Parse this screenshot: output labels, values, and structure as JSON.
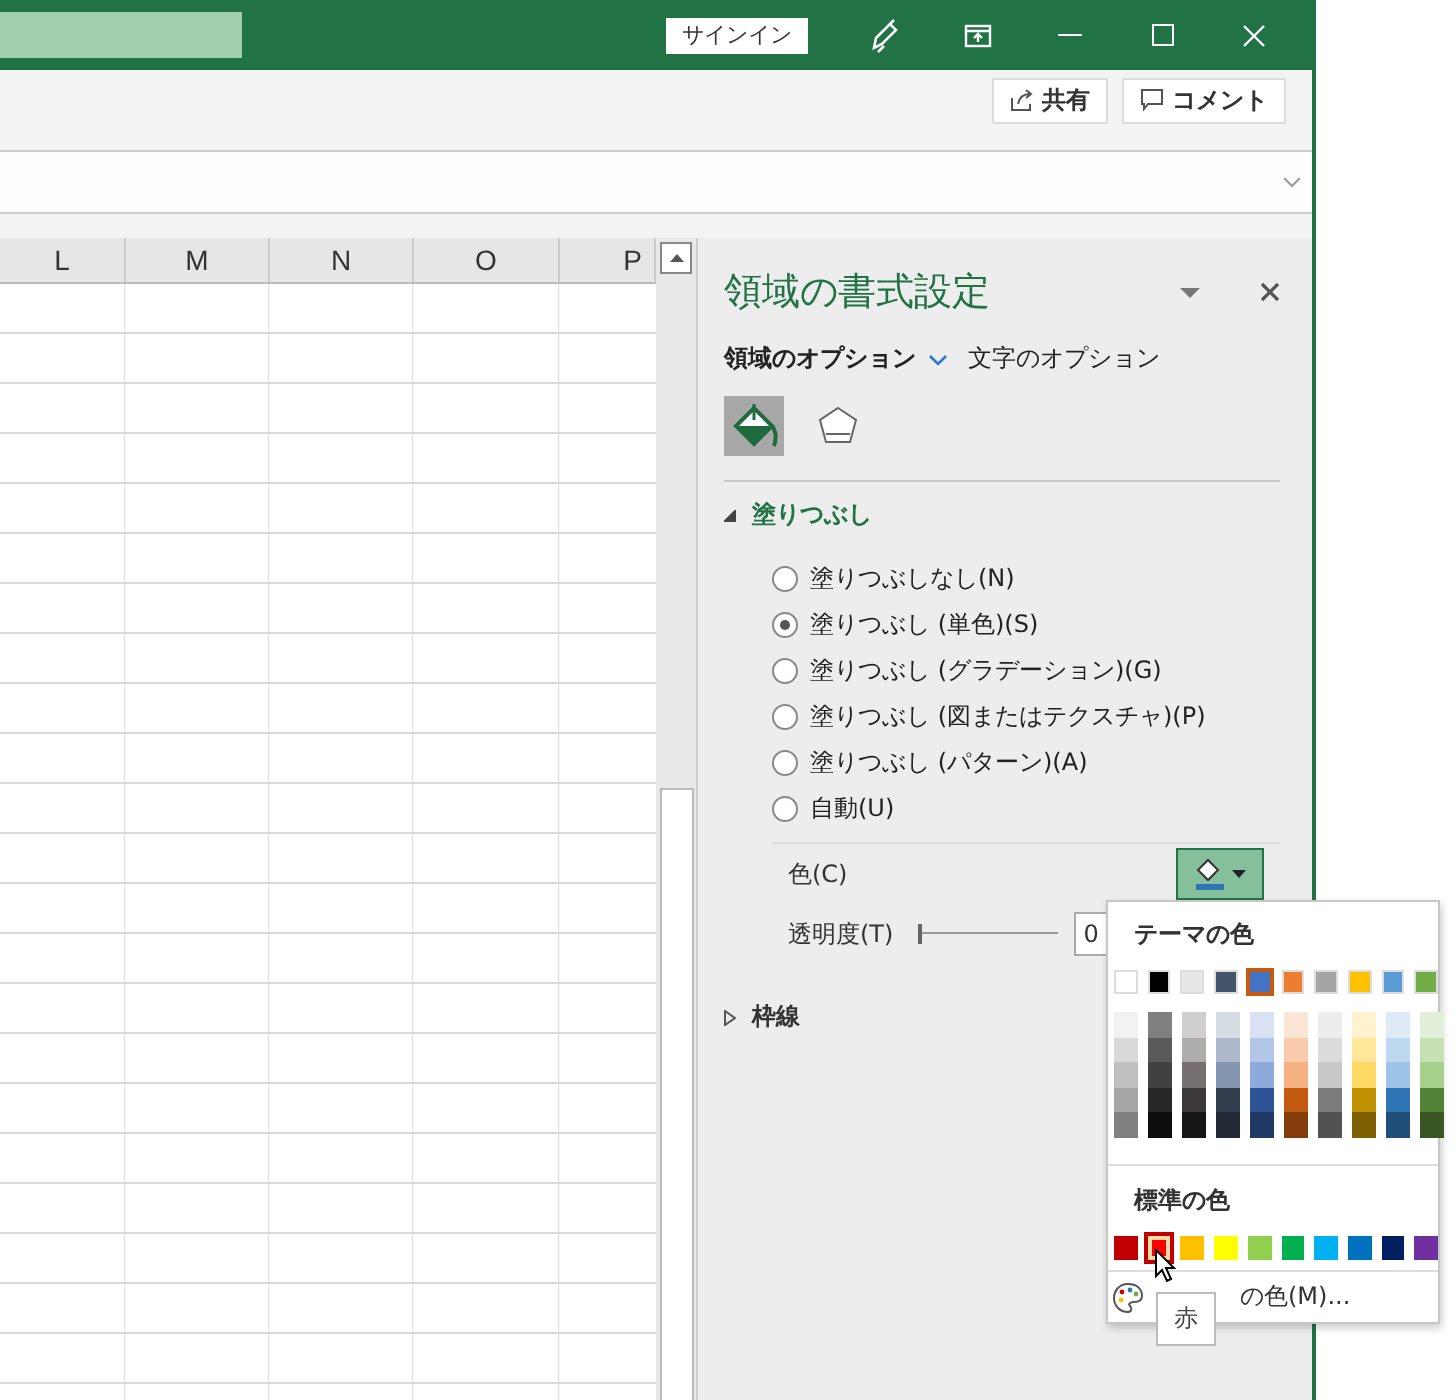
{
  "title_bar": {
    "signin_button": "サインイン"
  },
  "ribbon": {
    "buttons": [
      "共有",
      "コメント"
    ]
  },
  "sheet": {
    "columns": [
      "L",
      "M",
      "N",
      "O",
      "P"
    ]
  },
  "pane": {
    "title": "領域の書式設定",
    "tabs": [
      {
        "label": "領域のオプション",
        "selected": true
      },
      {
        "label": "文字のオプション",
        "selected": false
      }
    ],
    "icon_tabs": [
      {
        "kind": "fill",
        "selected": true
      },
      {
        "kind": "effects",
        "selected": false
      }
    ],
    "fill_section": {
      "label": "塗りつぶし",
      "expanded": true,
      "options": [
        {
          "label": "塗りつぶしなし(N)",
          "selected": false
        },
        {
          "label": "塗りつぶし (単色)(S)",
          "selected": true
        },
        {
          "label": "塗りつぶし (グラデーション)(G)",
          "selected": false
        },
        {
          "label": "塗りつぶし (図またはテクスチャ)(P)",
          "selected": false
        },
        {
          "label": "塗りつぶし (パターン)(A)",
          "selected": false
        },
        {
          "label": "自動(U)",
          "selected": false
        }
      ],
      "color_label": "色(C)",
      "transparency": {
        "label": "透明度(T)",
        "level": 0,
        "value": "0"
      }
    },
    "border_section": {
      "label": "枠線",
      "expanded": false
    }
  },
  "color_popup": {
    "theme_label": "テーマの色",
    "theme_colors": [
      {
        "color": "#ffffff",
        "selected": false,
        "shades": [
          {
            "color": "#f2f2f2"
          },
          {
            "color": "#d9d9d9"
          },
          {
            "color": "#bfbfbf"
          },
          {
            "color": "#a6a6a6"
          },
          {
            "color": "#808080"
          }
        ]
      },
      {
        "color": "#000000",
        "selected": false,
        "shades": [
          {
            "color": "#7f7f7f"
          },
          {
            "color": "#595959"
          },
          {
            "color": "#404040"
          },
          {
            "color": "#262626"
          },
          {
            "color": "#0d0d0d"
          }
        ]
      },
      {
        "color": "#e7e6e6",
        "selected": false,
        "shades": [
          {
            "color": "#d0cece"
          },
          {
            "color": "#aeabab"
          },
          {
            "color": "#757171"
          },
          {
            "color": "#3a3838"
          },
          {
            "color": "#171616"
          }
        ]
      },
      {
        "color": "#44546a",
        "selected": false,
        "shades": [
          {
            "color": "#d6dce4"
          },
          {
            "color": "#adb9ca"
          },
          {
            "color": "#8496b0"
          },
          {
            "color": "#333f4f"
          },
          {
            "color": "#222a35"
          }
        ]
      },
      {
        "color": "#4472c4",
        "selected": true,
        "shades": [
          {
            "color": "#d9e2f3"
          },
          {
            "color": "#b4c6e7"
          },
          {
            "color": "#8eaadb"
          },
          {
            "color": "#2f5496"
          },
          {
            "color": "#1f3864"
          }
        ]
      },
      {
        "color": "#ed7d31",
        "selected": false,
        "shades": [
          {
            "color": "#fbe5d5"
          },
          {
            "color": "#f7cbac"
          },
          {
            "color": "#f4b183"
          },
          {
            "color": "#c55a11"
          },
          {
            "color": "#843c0b"
          }
        ]
      },
      {
        "color": "#a5a5a5",
        "selected": false,
        "shades": [
          {
            "color": "#ededed"
          },
          {
            "color": "#dbdbdb"
          },
          {
            "color": "#c9c9c9"
          },
          {
            "color": "#7b7b7b"
          },
          {
            "color": "#525252"
          }
        ]
      },
      {
        "color": "#ffc000",
        "selected": false,
        "shades": [
          {
            "color": "#fff2cc"
          },
          {
            "color": "#ffe699"
          },
          {
            "color": "#ffd966"
          },
          {
            "color": "#bf9000"
          },
          {
            "color": "#7f6000"
          }
        ]
      },
      {
        "color": "#5b9bd5",
        "selected": false,
        "shades": [
          {
            "color": "#deebf6"
          },
          {
            "color": "#bdd7ee"
          },
          {
            "color": "#9dc3e6"
          },
          {
            "color": "#2e75b5"
          },
          {
            "color": "#1f4e79"
          }
        ]
      },
      {
        "color": "#70ad47",
        "selected": false,
        "shades": [
          {
            "color": "#e2efd9"
          },
          {
            "color": "#c5e0b3"
          },
          {
            "color": "#a8d08d"
          },
          {
            "color": "#538135"
          },
          {
            "color": "#375623"
          }
        ]
      }
    ],
    "standard_label": "標準の色",
    "standard_colors": [
      {
        "color": "#c00000",
        "selected": false
      },
      {
        "color": "#ff0000",
        "selected": true
      },
      {
        "color": "#ffc000",
        "selected": false
      },
      {
        "color": "#ffff00",
        "selected": false
      },
      {
        "color": "#92d050",
        "selected": false
      },
      {
        "color": "#00b050",
        "selected": false
      },
      {
        "color": "#00b0f0",
        "selected": false
      },
      {
        "color": "#0070c0",
        "selected": false
      },
      {
        "color": "#002060",
        "selected": false
      },
      {
        "color": "#7030a0",
        "selected": false
      }
    ],
    "more_colors": "の色(M)...",
    "tooltip": "赤"
  }
}
